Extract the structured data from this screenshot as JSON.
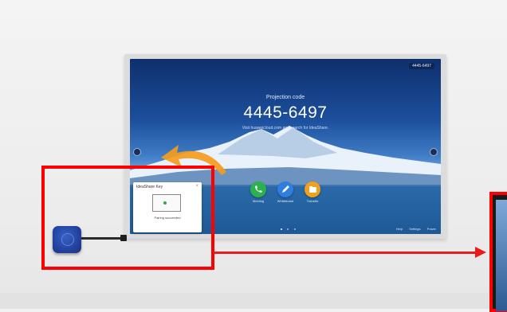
{
  "screen": {
    "top_right_code": "4445-6497",
    "projection_label": "Projection code",
    "projection_code": "4445-6497",
    "instruction": "Visit huaweicloud.com and search for IdeaShare."
  },
  "apps": [
    {
      "label": "Meeting",
      "color": "#2bb24c"
    },
    {
      "label": "Whiteboard",
      "color": "#2f7de1"
    },
    {
      "label": "Transfer",
      "color": "#f0a020"
    }
  ],
  "bottom_bar": {
    "help": "Help",
    "settings": "Settings",
    "power": "Power"
  },
  "popup": {
    "title": "IdeaShare Key",
    "close": "×",
    "status": "Pairing succeeded",
    "hint": ""
  },
  "colors": {
    "highlight": "#ff0000",
    "screen_top": "#0f2f6e",
    "accent_arrow": "#f39c1c",
    "key": "#2342a0"
  }
}
